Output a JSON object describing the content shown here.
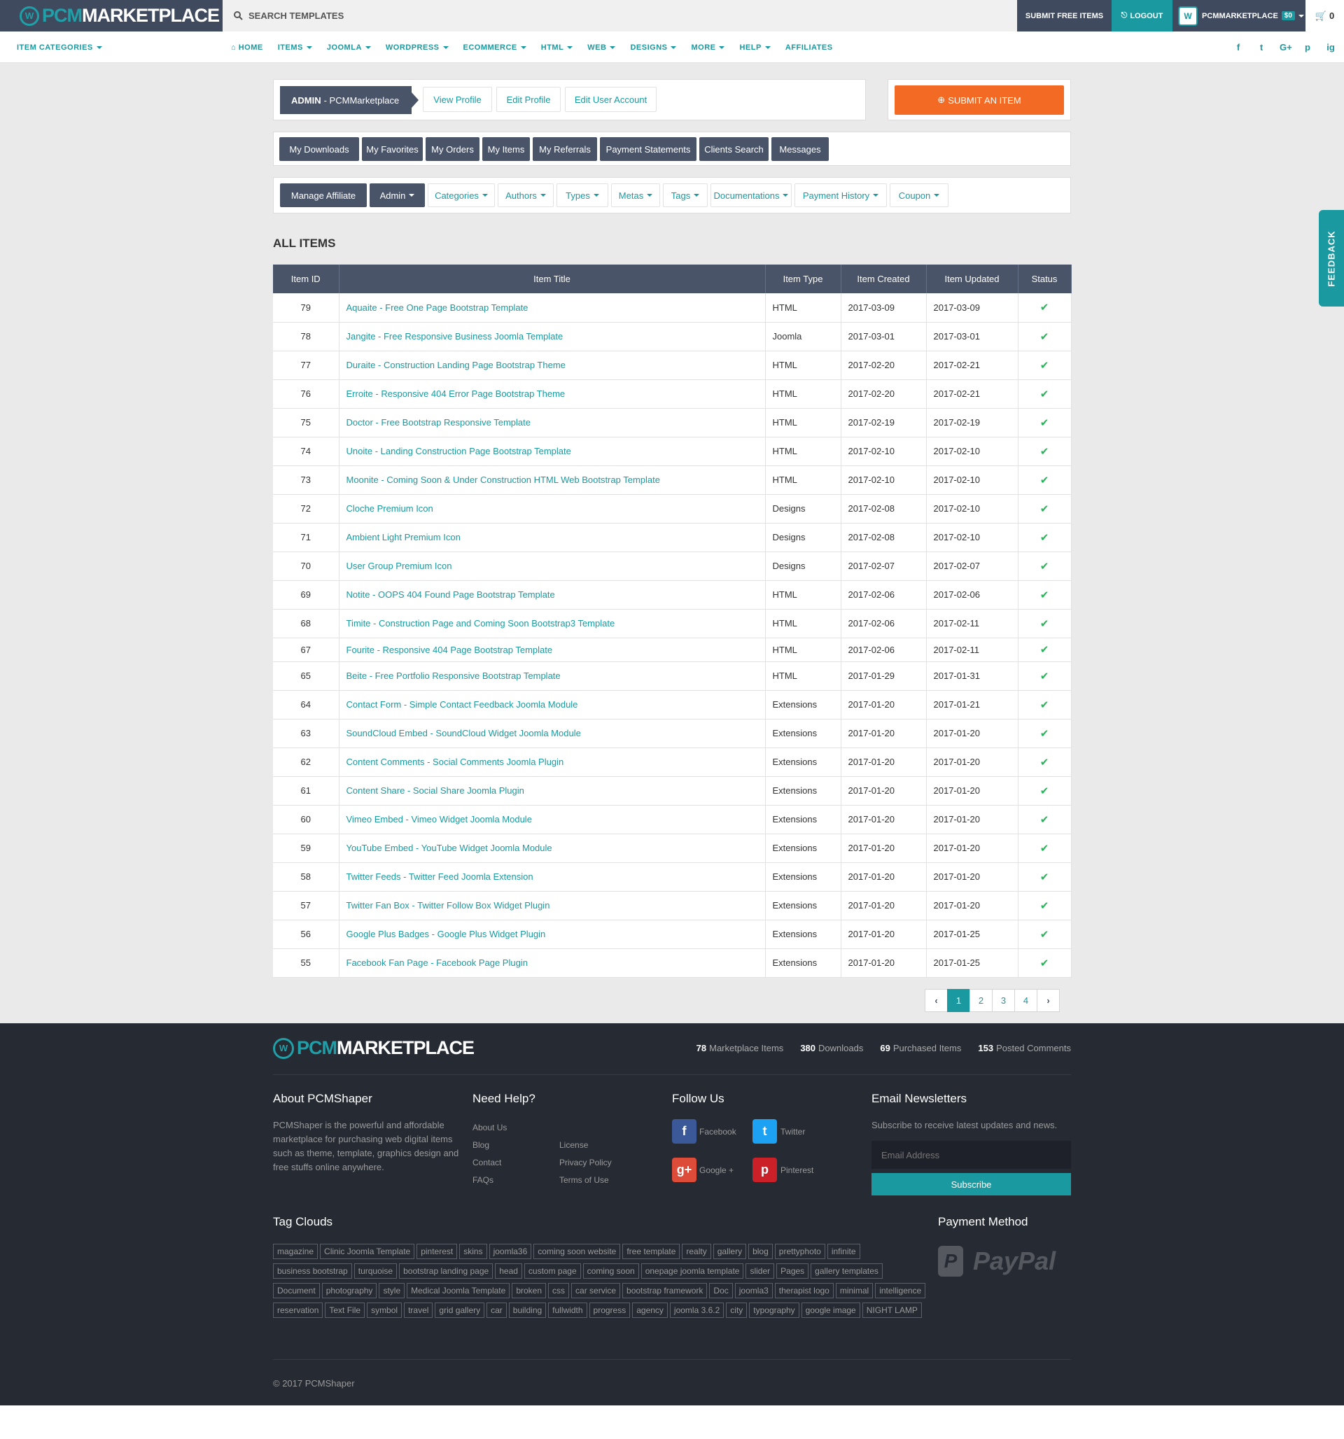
{
  "topbar": {
    "logo_pcm": "PCM",
    "logo_rest": "MARKETPLACE",
    "search_placeholder": "SEARCH TEMPLATES",
    "submit_free": "SUBMIT FREE ITEMS",
    "logout": "LOGOUT",
    "username": "PCMMARKETPLACE",
    "balance": "$0",
    "cart_count": "0"
  },
  "nav": {
    "categories": "ITEM CATEGORIES",
    "home": "HOME",
    "items": [
      "ITEMS",
      "JOOMLA",
      "WORDPRESS",
      "ECOMMERCE",
      "HTML",
      "WEB",
      "DESIGNS",
      "MORE",
      "HELP"
    ],
    "affiliates": "AFFILIATES",
    "social": [
      "f",
      "t",
      "G+",
      "p",
      "ig"
    ]
  },
  "profile": {
    "role": "ADMIN",
    "name": " - PCMMarketplace",
    "view_profile": "View Profile",
    "edit_profile": "Edit Profile",
    "edit_account": "Edit User Account",
    "submit_item": "SUBMIT AN ITEM"
  },
  "user_tabs": [
    "My Downloads",
    "My Favorites",
    "My Orders",
    "My Items",
    "My Referrals",
    "Payment Statements",
    "Clients Search",
    "Messages"
  ],
  "admin_tabs": {
    "manage_affiliate": "Manage Affiliate",
    "admin": "Admin",
    "menus": [
      "Categories",
      "Authors",
      "Types",
      "Metas",
      "Tags",
      "Documentations",
      "Payment History",
      "Coupon"
    ]
  },
  "items_title": "ALL ITEMS",
  "table": {
    "headers": [
      "Item ID",
      "Item Title",
      "Item Type",
      "Item Created",
      "Item Updated",
      "Status"
    ],
    "rows": [
      [
        "79",
        "Aquaite - Free One Page Bootstrap Template",
        "HTML",
        "2017-03-09",
        "2017-03-09"
      ],
      [
        "78",
        "Jangite - Free Responsive Business Joomla Template",
        "Joomla",
        "2017-03-01",
        "2017-03-01"
      ],
      [
        "77",
        "Duraite - Construction Landing Page Bootstrap Theme",
        "HTML",
        "2017-02-20",
        "2017-02-21"
      ],
      [
        "76",
        "Erroite - Responsive 404 Error Page Bootstrap Theme",
        "HTML",
        "2017-02-20",
        "2017-02-21"
      ],
      [
        "75",
        "Doctor - Free Bootstrap Responsive Template",
        "HTML",
        "2017-02-19",
        "2017-02-19"
      ],
      [
        "74",
        "Unoite - Landing Construction Page Bootstrap Template",
        "HTML",
        "2017-02-10",
        "2017-02-10"
      ],
      [
        "73",
        "Moonite - Coming Soon & Under Construction HTML Web Bootstrap Template",
        "HTML",
        "2017-02-10",
        "2017-02-10"
      ],
      [
        "72",
        "Cloche Premium Icon",
        "Designs",
        "2017-02-08",
        "2017-02-10"
      ],
      [
        "71",
        "Ambient Light Premium Icon",
        "Designs",
        "2017-02-08",
        "2017-02-10"
      ],
      [
        "70",
        "User Group Premium Icon",
        "Designs",
        "2017-02-07",
        "2017-02-07"
      ],
      [
        "69",
        "Notite - OOPS 404 Found Page Bootstrap Template",
        "HTML",
        "2017-02-06",
        "2017-02-06"
      ],
      [
        "68",
        "Timite - Construction Page and Coming Soon Bootstrap3 Template",
        "HTML",
        "2017-02-06",
        "2017-02-11"
      ],
      [
        "67",
        "Fourite - Responsive 404 Page Bootstrap Template",
        "HTML",
        "2017-02-06",
        "2017-02-11"
      ],
      [
        "65",
        "Beite - Free Portfolio Responsive Bootstrap Template",
        "HTML",
        "2017-01-29",
        "2017-01-31"
      ],
      [
        "64",
        "Contact Form - Simple Contact Feedback Joomla Module",
        "Extensions",
        "2017-01-20",
        "2017-01-21"
      ],
      [
        "63",
        "SoundCloud Embed - SoundCloud Widget Joomla Module",
        "Extensions",
        "2017-01-20",
        "2017-01-20"
      ],
      [
        "62",
        "Content Comments - Social Comments Joomla Plugin",
        "Extensions",
        "2017-01-20",
        "2017-01-20"
      ],
      [
        "61",
        "Content Share - Social Share Joomla Plugin",
        "Extensions",
        "2017-01-20",
        "2017-01-20"
      ],
      [
        "60",
        "Vimeo Embed - Vimeo Widget Joomla Module",
        "Extensions",
        "2017-01-20",
        "2017-01-20"
      ],
      [
        "59",
        "YouTube Embed - YouTube Widget Joomla Module",
        "Extensions",
        "2017-01-20",
        "2017-01-20"
      ],
      [
        "58",
        "Twitter Feeds - Twitter Feed Joomla Extension",
        "Extensions",
        "2017-01-20",
        "2017-01-20"
      ],
      [
        "57",
        "Twitter Fan Box - Twitter Follow Box Widget Plugin",
        "Extensions",
        "2017-01-20",
        "2017-01-20"
      ],
      [
        "56",
        "Google Plus Badges - Google Plus Widget Plugin",
        "Extensions",
        "2017-01-20",
        "2017-01-25"
      ],
      [
        "55",
        "Facebook Fan Page - Facebook Page Plugin",
        "Extensions",
        "2017-01-20",
        "2017-01-25"
      ]
    ]
  },
  "pagination": {
    "pages": [
      "1",
      "2",
      "3",
      "4"
    ],
    "current": "1"
  },
  "footer": {
    "stats": [
      {
        "num": "78",
        "label": "Marketplace Items"
      },
      {
        "num": "380",
        "label": "Downloads"
      },
      {
        "num": "69",
        "label": "Purchased Items"
      },
      {
        "num": "153",
        "label": "Posted Comments"
      }
    ],
    "about_title": "About PCMShaper",
    "about_text": "PCMShaper is the powerful and affordable marketplace for purchasing web digital items such as theme, template, graphics design and free stuffs online anywhere.",
    "help_title": "Need Help?",
    "help_links_1": [
      "About Us",
      "Blog",
      "Contact",
      "FAQs"
    ],
    "help_links_2": [
      "License",
      "Privacy Policy",
      "Terms of Use"
    ],
    "follow_title": "Follow Us",
    "follow": [
      "Facebook",
      "Twitter",
      "Google +",
      "Pinterest"
    ],
    "newsletter_title": "Email Newsletters",
    "newsletter_text": "Subscribe to receive latest updates and news.",
    "email_placeholder": "Email Address",
    "subscribe": "Subscribe",
    "tags_title": "Tag Clouds",
    "tags": [
      "magazine",
      "Clinic Joomla Template",
      "pinterest",
      "skins",
      "joomla36",
      "coming soon website",
      "free template",
      "realty",
      "gallery",
      "blog",
      "prettyphoto",
      "infinite",
      "business bootstrap",
      "turquoise",
      "bootstrap landing page",
      "head",
      "custom page",
      "coming soon",
      "onepage joomla template",
      "slider",
      "Pages",
      "gallery templates",
      "Document",
      "photography",
      "style",
      "Medical Joomla Template",
      "broken",
      "css",
      "car service",
      "bootstrap framework",
      "Doc",
      "joomla3",
      "therapist logo",
      "minimal",
      "intelligence",
      "reservation",
      "Text File",
      "symbol",
      "travel",
      "grid gallery",
      "car",
      "building",
      "fullwidth",
      "progress",
      "agency",
      "joomla 3.6.2",
      "city",
      "typography",
      "google image",
      "NIGHT LAMP"
    ],
    "payment_title": "Payment Method",
    "paypal": "PayPal",
    "copyright": "© 2017 PCMShaper"
  },
  "feedback": "FEEDBACK",
  "colors": {
    "teal": "#1a9aa0",
    "dark": "#4a5469",
    "orange": "#f26a23",
    "footer": "#262a33",
    "check": "#2ab25a"
  }
}
